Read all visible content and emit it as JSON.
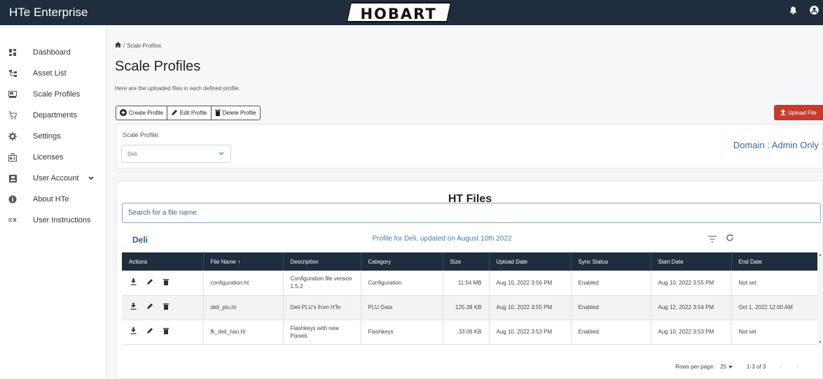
{
  "app": {
    "title": "HTe Enterprise",
    "brand": "HOBART"
  },
  "sidebar": {
    "items": [
      {
        "label": "Dashboard",
        "icon": "dashboard-icon"
      },
      {
        "label": "Asset List",
        "icon": "asset-tree-icon"
      },
      {
        "label": "Scale Profiles",
        "icon": "scale-icon"
      },
      {
        "label": "Departments",
        "icon": "cart-icon"
      },
      {
        "label": "Settings",
        "icon": "gear-icon"
      },
      {
        "label": "Licenses",
        "icon": "license-icon"
      },
      {
        "label": "User Account",
        "icon": "user-card-icon"
      },
      {
        "label": "About HTe",
        "icon": "info-icon"
      },
      {
        "label": "User Instructions",
        "icon": "instructions-icon"
      }
    ]
  },
  "breadcrumb": {
    "current": "Scale Profiles",
    "separator": "/"
  },
  "page": {
    "title": "Scale Profiles",
    "description": "Here are the uploaded files in each defined profile."
  },
  "toolbar": {
    "create": "Create Profile",
    "edit": "Edit Profile",
    "delete": "Delete Profile",
    "upload": "Upload File"
  },
  "profile": {
    "label": "Scale Profile:",
    "selected": "Deli",
    "domain": "Domain : Admin Only"
  },
  "files": {
    "title": "HT Files",
    "search_placeholder": "Search for a file name",
    "profile_name": "Deli",
    "profile_info": "Profile for Deli, updated on August 10th 2022",
    "columns": [
      "Actions",
      "File Name ↑",
      "Description",
      "Category",
      "Size",
      "Upload Date",
      "Sync Status",
      "Start Date",
      "End Date"
    ],
    "rows": [
      {
        "file": "configuration.ht",
        "desc": "Configuration file version 1.5.2",
        "cat": "Configuration",
        "size": "11.54 MB",
        "upload": "Aug 10, 2022 3:56 PM",
        "sync": "Enabled",
        "start": "Aug 10, 2022 3:55 PM",
        "end": "Not set"
      },
      {
        "file": "deli_plu.ht",
        "desc": "Deli PLU's from HTe",
        "cat": "PLU Data",
        "size": "125.38 KB",
        "upload": "Aug 10, 2022 3:55 PM",
        "sync": "Enabled",
        "start": "Aug 12, 2022 3:54 PM",
        "end": "Oct 1, 2022 12:00 AM"
      },
      {
        "file": "fk_deli_han.ht",
        "desc": "Flashkeys with new Panels",
        "cat": "Flashkeys",
        "size": "33.06 KB",
        "upload": "Aug 10, 2022 3:53 PM",
        "sync": "Enabled",
        "start": "Aug 10, 2022 3:53 PM",
        "end": "Not set"
      }
    ]
  },
  "pagination": {
    "rows_per_page_label": "Rows per page:",
    "rows_per_page": "25",
    "range": "1-3 of 3"
  },
  "colors": {
    "header": "#1f2d3f",
    "upload": "#c73b2c",
    "link": "#2d5a8a"
  }
}
